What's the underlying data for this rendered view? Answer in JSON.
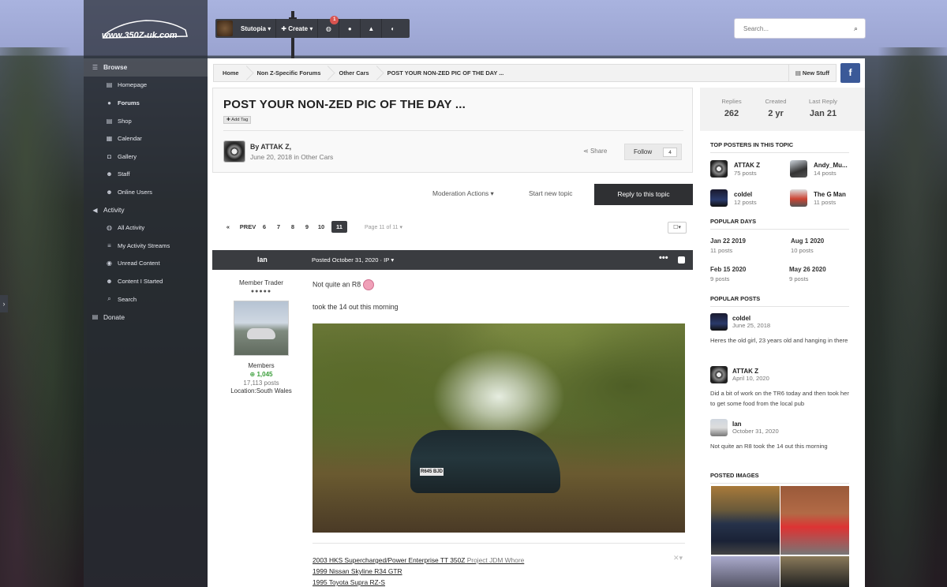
{
  "logo": {
    "text": "www.350Z-uk.com"
  },
  "sidebar": {
    "browse": "Browse",
    "items": [
      "Homepage",
      "Forums",
      "Shop",
      "Calendar",
      "Gallery",
      "Staff",
      "Online Users"
    ],
    "activity": "Activity",
    "activity_items": [
      "All Activity",
      "My Activity Streams",
      "Unread Content",
      "Content I Started",
      "Search"
    ],
    "donate": "Donate"
  },
  "userbar": {
    "username": "Stutopia",
    "create": "Create",
    "notif_count": "1"
  },
  "search": {
    "placeholder": "Search..."
  },
  "breadcrumb": [
    "Home",
    "Non Z-Specific Forums",
    "Other Cars",
    "POST YOUR NON-ZED PIC OF THE DAY ..."
  ],
  "new_stuff": "New Stuff",
  "topic": {
    "title": "POST YOUR NON-ZED PIC OF THE DAY ...",
    "add_tag": "Add Tag",
    "by": "By ATTAK Z,",
    "date_prefix": "June 20, 2018 in ",
    "forum": "Other Cars",
    "share": "Share",
    "follow": "Follow",
    "follow_count": "4"
  },
  "actions": {
    "moderation": "Moderation Actions",
    "new_topic": "Start new topic",
    "reply": "Reply to this topic"
  },
  "pagination": {
    "first": "«",
    "prev": "PREV",
    "pages": [
      "6",
      "7",
      "8",
      "9",
      "10"
    ],
    "current": "11",
    "page_of": "Page 11 of 11"
  },
  "post": {
    "author": "Ian",
    "posted": "Posted October 31, 2020 · IP",
    "role": "Member Trader",
    "group": "Members",
    "reputation": "1,045",
    "posts": "17,113 posts",
    "location": "Location:South Wales",
    "line1": "Not quite an R8",
    "line2": "took the 14 out this morning",
    "plate": "R645 BJD",
    "sig1": "2003 HKS Supercharged/Power Enterprise TT 350Z",
    "sig1_suffix": "Project JDM Whore",
    "sig2": "1999 Nissan Skyline R34 GTR",
    "sig3": "1995 Toyota Supra RZ-S"
  },
  "stats": {
    "replies_label": "Replies",
    "replies": "262",
    "created_label": "Created",
    "created": "2 yr",
    "last_label": "Last Reply",
    "last": "Jan 21"
  },
  "top_posters": {
    "heading": "TOP POSTERS IN THIS TOPIC",
    "list": [
      {
        "name": "ATTAK Z",
        "posts": "75 posts"
      },
      {
        "name": "Andy_Mu...",
        "posts": "14 posts"
      },
      {
        "name": "coldel",
        "posts": "12 posts"
      },
      {
        "name": "The G Man",
        "posts": "11 posts"
      }
    ]
  },
  "popular_days": {
    "heading": "POPULAR DAYS",
    "list": [
      {
        "date": "Jan 22 2019",
        "posts": "11 posts"
      },
      {
        "date": "Aug 1 2020",
        "posts": "10 posts"
      },
      {
        "date": "Feb 15 2020",
        "posts": "9 posts"
      },
      {
        "date": "May 26 2020",
        "posts": "9 posts"
      }
    ]
  },
  "popular_posts": {
    "heading": "POPULAR POSTS",
    "list": [
      {
        "name": "coldel",
        "date": "June 25, 2018",
        "text": "Heres the old girl, 23 years old and hanging in there"
      },
      {
        "name": "ATTAK Z",
        "date": "April 10, 2020",
        "text": "Did a bit of work on the TR6 today and then took her to get some food from the local pub"
      },
      {
        "name": "Ian",
        "date": "October 31, 2020",
        "text": "Not quite an R8   took the 14 out this morning"
      }
    ]
  },
  "posted_images": {
    "heading": "POSTED IMAGES"
  }
}
